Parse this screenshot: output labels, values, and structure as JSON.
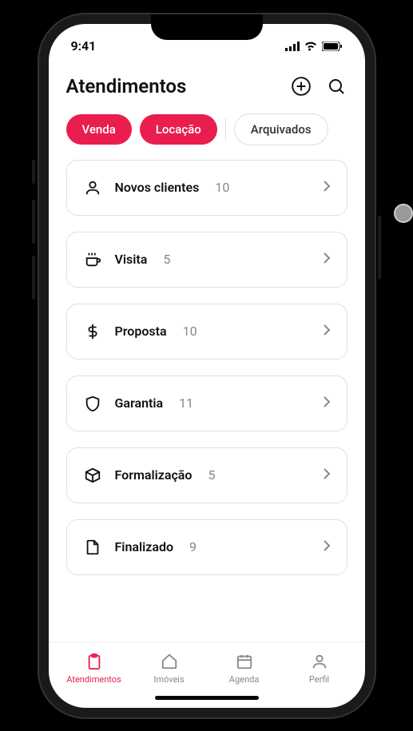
{
  "status": {
    "time": "9:41"
  },
  "header": {
    "title": "Atendimentos"
  },
  "filters": {
    "venda": "Venda",
    "locacao": "Locação",
    "arquivados": "Arquivados"
  },
  "stages": [
    {
      "icon": "person",
      "label": "Novos clientes",
      "count": "10"
    },
    {
      "icon": "coffee",
      "label": "Visita",
      "count": "5"
    },
    {
      "icon": "dollar",
      "label": "Proposta",
      "count": "10"
    },
    {
      "icon": "shield",
      "label": "Garantia",
      "count": "11"
    },
    {
      "icon": "box",
      "label": "Formalização",
      "count": "5"
    },
    {
      "icon": "file",
      "label": "Finalizado",
      "count": "9"
    }
  ],
  "nav": {
    "atendimentos": "Atendimentos",
    "imoveis": "Imóveis",
    "agenda": "Agenda",
    "perfil": "Perfil"
  }
}
